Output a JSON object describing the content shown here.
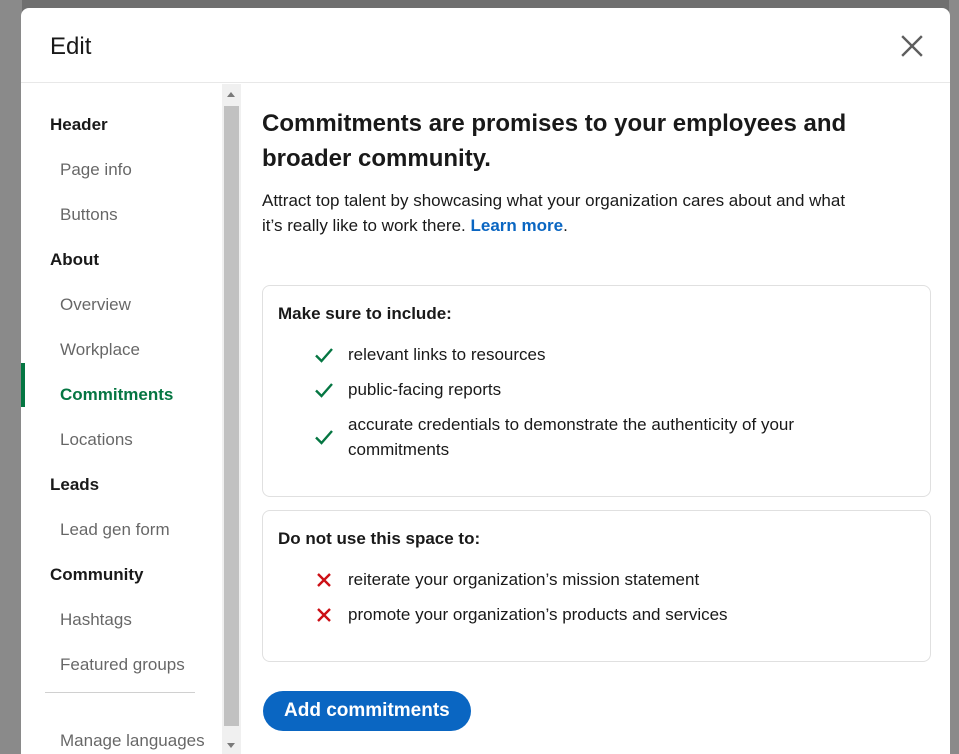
{
  "modal": {
    "title": "Edit",
    "close_icon": "close-icon"
  },
  "sidebar": {
    "sections": [
      {
        "label": "Header",
        "items": [
          "Page info",
          "Buttons"
        ]
      },
      {
        "label": "About",
        "items": [
          "Overview",
          "Workplace",
          "Commitments",
          "Locations"
        ]
      },
      {
        "label": "Leads",
        "items": [
          "Lead gen form"
        ]
      },
      {
        "label": "Community",
        "items": [
          "Hashtags",
          "Featured groups"
        ]
      }
    ],
    "active_item": "Commitments",
    "footer_item": "Manage languages"
  },
  "content": {
    "heading": "Commitments are promises to your employees and broader community.",
    "intro": "Attract top talent by showcasing what your organization cares about and what it’s really like to work there.",
    "learn_more": "Learn more",
    "intro_end": ".",
    "include_card": {
      "title": "Make sure to include:",
      "items": [
        "relevant links to resources",
        "public-facing reports",
        "accurate credentials to demonstrate the authenticity of your commitments"
      ]
    },
    "avoid_card": {
      "title": "Do not use this space to:",
      "items": [
        "reiterate your organization’s mission statement",
        "promote your organization’s products and services"
      ]
    },
    "add_button": "Add commitments"
  },
  "colors": {
    "accent_green": "#057642",
    "primary_blue": "#0a66c2",
    "error_red": "#cc1016"
  }
}
